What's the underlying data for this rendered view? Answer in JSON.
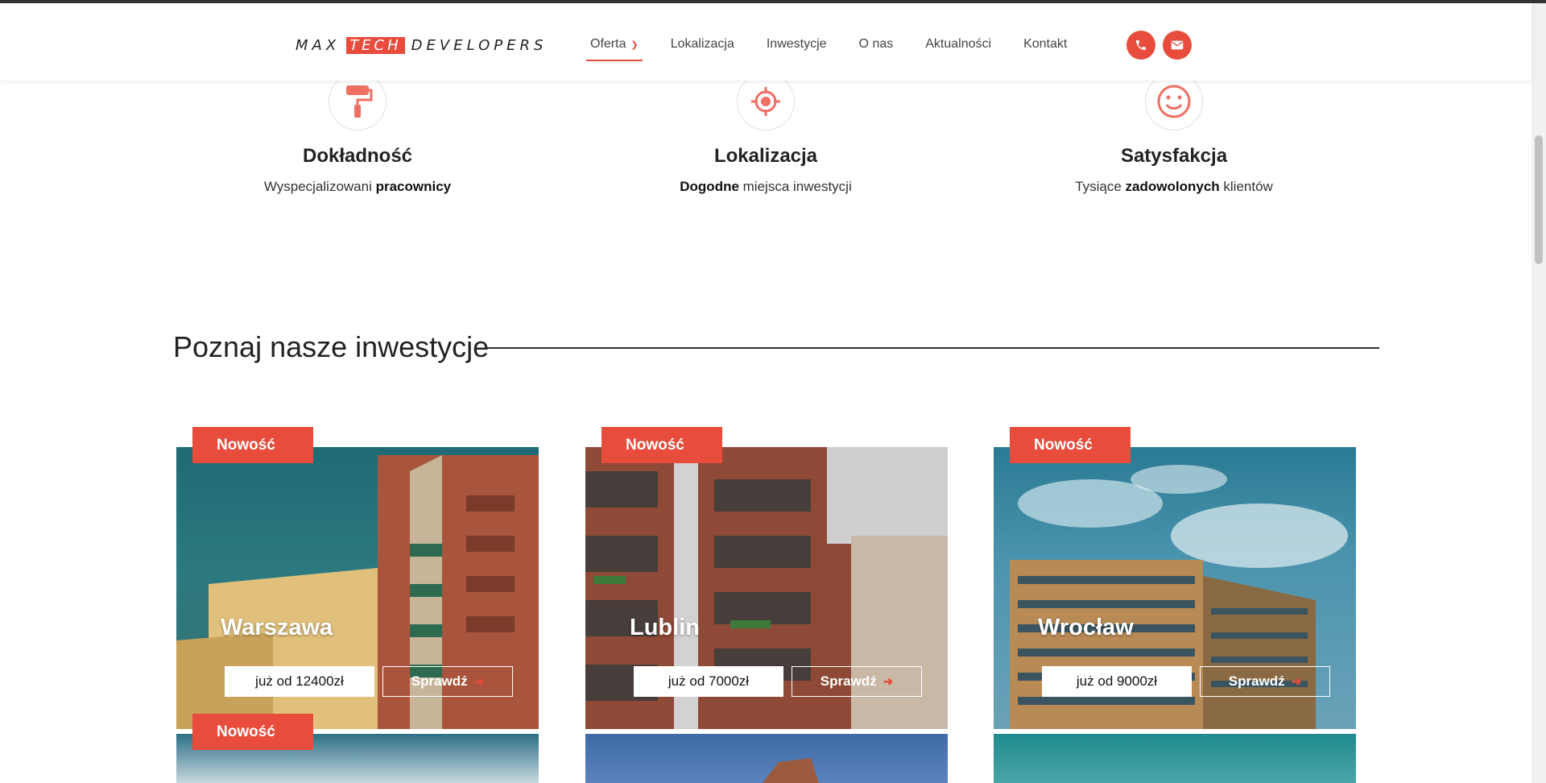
{
  "logo": {
    "part1": "MAX",
    "part2": "TECH",
    "part3": "DEVELOPERS"
  },
  "nav": {
    "items": [
      "Oferta",
      "Lokalizacja",
      "Inwestycje",
      "O nas",
      "Aktualności",
      "Kontakt"
    ],
    "active_index": 0
  },
  "header_buttons": {
    "phone_icon": "phone-icon",
    "mail_icon": "mail-icon"
  },
  "features": [
    {
      "title": "Dokładność",
      "desc_plain": "Wyspecjalizowani ",
      "desc_bold": "pracownicy",
      "desc_after": "",
      "icon": "paint-roller-icon"
    },
    {
      "title": "Lokalizacja",
      "desc_plain": "",
      "desc_bold": "Dogodne",
      "desc_after": " miejsca inwestycji",
      "icon": "target-icon"
    },
    {
      "title": "Satysfakcja",
      "desc_plain": "Tysiące ",
      "desc_bold": "zadowolonych",
      "desc_after": " klientów",
      "icon": "smile-icon"
    }
  ],
  "section": {
    "title": "Poznaj nasze inwestycje"
  },
  "cards": [
    {
      "badge": "Nowość",
      "city": "Warszawa",
      "price": "już od 12400zł",
      "button": "Sprawdź"
    },
    {
      "badge": "Nowość",
      "city": "Lublin",
      "price": "już od 7000zł",
      "button": "Sprawdź"
    },
    {
      "badge": "Nowość",
      "city": "Wrocław",
      "price": "już od 9000zł",
      "button": "Sprawdź"
    }
  ],
  "next_row": {
    "badge": "Nowość"
  },
  "colors": {
    "accent": "#e74c3c",
    "text": "#222222"
  }
}
